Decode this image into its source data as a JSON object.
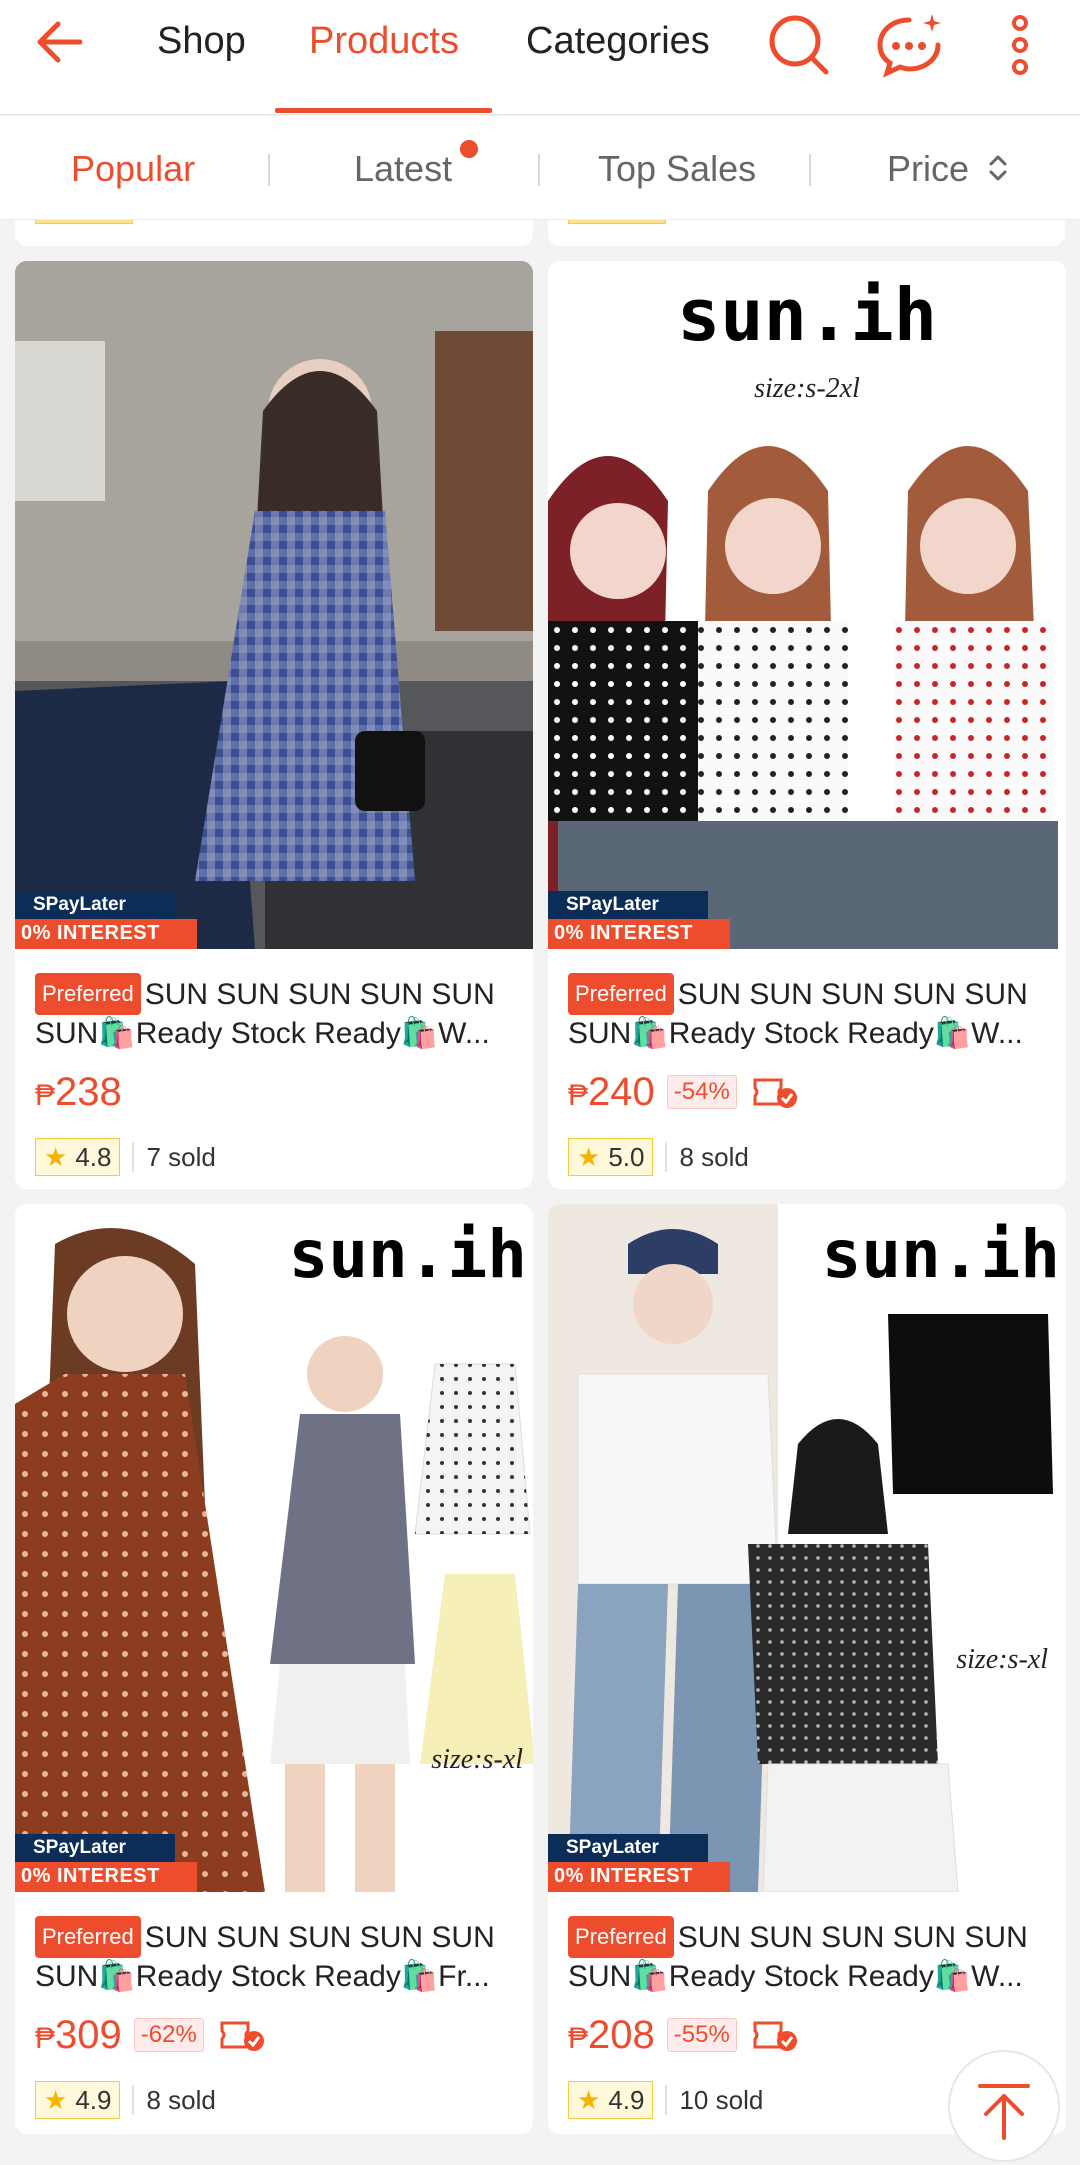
{
  "header": {
    "tabs": [
      {
        "label": "Shop"
      },
      {
        "label": "Products"
      },
      {
        "label": "Categories"
      }
    ]
  },
  "sort": {
    "options": [
      {
        "label": "Popular"
      },
      {
        "label": "Latest"
      },
      {
        "label": "Top Sales"
      },
      {
        "label": "Price"
      }
    ]
  },
  "colors": {
    "accent": "#ee4d2d"
  },
  "products": [
    {
      "spay_top": "SPayLater",
      "spay_bottom": "0% INTEREST",
      "badge": "Preferred",
      "title": "SUN SUN SUN SUN SUN SUN🛍️Ready Stock Ready🛍️W...",
      "currency": "₱",
      "price": "238",
      "discount": "",
      "rating": "4.8",
      "sold": "7 sold"
    },
    {
      "spay_top": "SPayLater",
      "spay_bottom": "0% INTEREST",
      "brand": "sun.ih",
      "size": "size:s-2xl",
      "badge": "Preferred",
      "title": "SUN SUN SUN SUN SUN SUN🛍️Ready Stock Ready🛍️W...",
      "currency": "₱",
      "price": "240",
      "discount": "-54%",
      "rating": "5.0",
      "sold": "8 sold"
    },
    {
      "spay_top": "SPayLater",
      "spay_bottom": "0% INTEREST",
      "brand": "sun.ih",
      "size": "size:s-xl",
      "badge": "Preferred",
      "title": "SUN SUN SUN SUN SUN SUN🛍️Ready Stock Ready🛍️Fr...",
      "currency": "₱",
      "price": "309",
      "discount": "-62%",
      "rating": "4.9",
      "sold": "8 sold"
    },
    {
      "spay_top": "SPayLater",
      "spay_bottom": "0% INTEREST",
      "brand": "sun.ih",
      "size": "size:s-xl",
      "badge": "Preferred",
      "title": "SUN SUN SUN SUN SUN SUN🛍️Ready Stock Ready🛍️W...",
      "currency": "₱",
      "price": "208",
      "discount": "-55%",
      "rating": "4.9",
      "sold": "10 sold"
    }
  ]
}
